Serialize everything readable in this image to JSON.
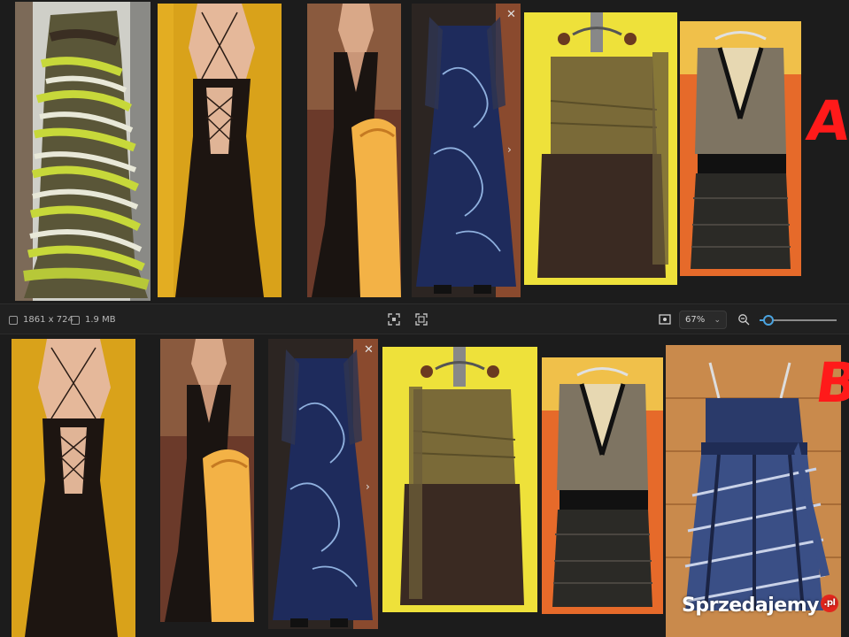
{
  "toolbar": {
    "dimensions": "1861 x 724",
    "file_size": "1.9 MB",
    "zoom_level": "67%",
    "zoom_slider_fraction": 0.12
  },
  "labels": {
    "row_a": "A",
    "row_b": "B"
  },
  "watermark": {
    "brand": "Sprzedajemy",
    "tld": ".pl"
  },
  "icons": {
    "image-info": "image-info-icon",
    "file-size": "file-size-icon",
    "fit-screen": "fit-screen-icon",
    "actual-size": "actual-size-icon",
    "display-settings": "display-settings-icon",
    "zoom-out": "zoom-out-icon",
    "close": "close-icon",
    "next": "chevron-right-icon"
  },
  "colors": {
    "accent": "#4aa3df",
    "label_red": "#ff1a1a",
    "background": "#202020"
  }
}
